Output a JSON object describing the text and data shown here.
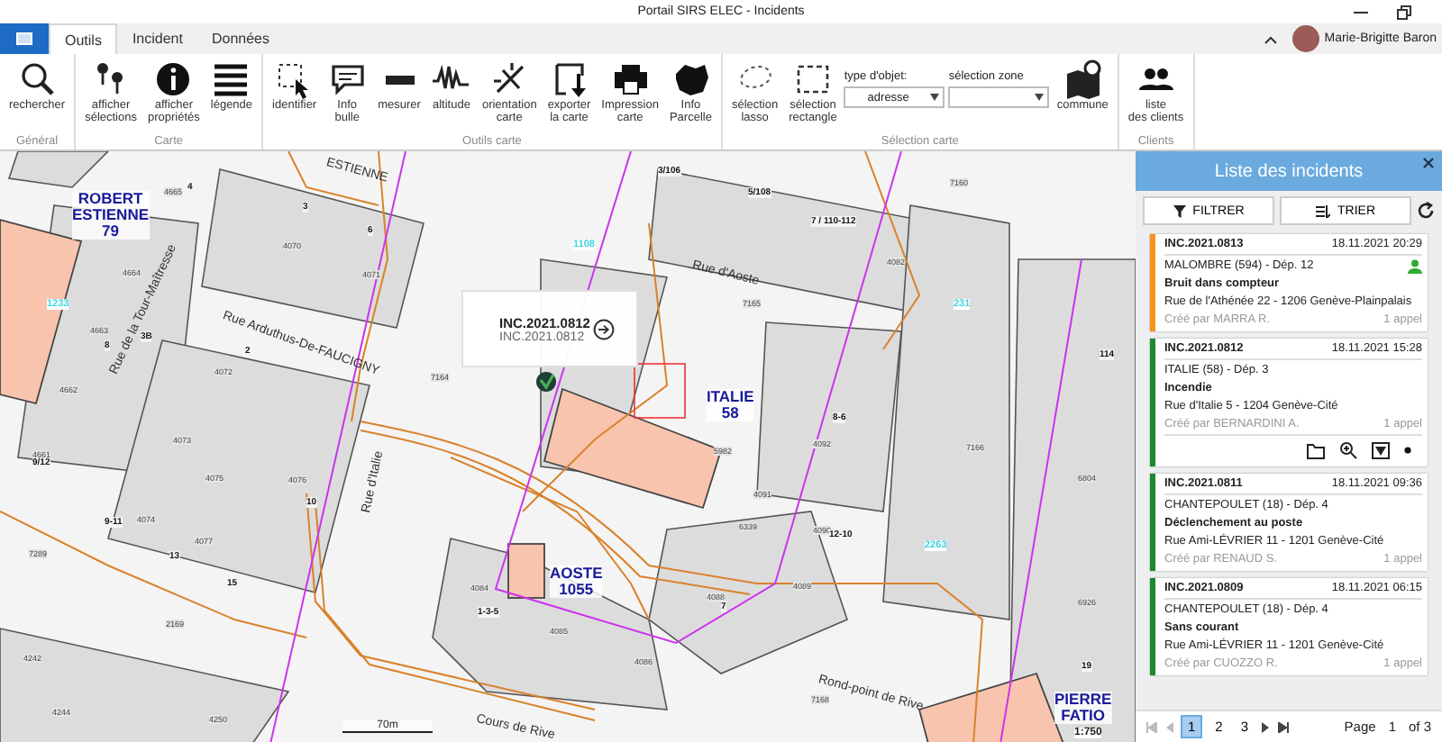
{
  "window": {
    "title": "Portail SIRS ELEC - Incidents"
  },
  "user": {
    "name": "Marie-Brigitte Baron"
  },
  "tabs": [
    {
      "label": "Outils",
      "selected": true
    },
    {
      "label": "Incident",
      "selected": false
    },
    {
      "label": "Données",
      "selected": false
    }
  ],
  "ribbon_groups": [
    {
      "label": "Général",
      "items": [
        {
          "kind": "button",
          "label": "rechercher"
        }
      ]
    },
    {
      "label": "Carte",
      "items": [
        {
          "kind": "button",
          "label": "afficher\nsélections"
        },
        {
          "kind": "button",
          "label": "afficher\npropriétés"
        },
        {
          "kind": "button",
          "label": "légende"
        }
      ]
    },
    {
      "label": "Outils carte",
      "items": [
        {
          "kind": "button",
          "label": "identifier"
        },
        {
          "kind": "button",
          "label": "Info\nbulle"
        },
        {
          "kind": "button",
          "label": "mesurer"
        },
        {
          "kind": "button",
          "label": "altitude"
        },
        {
          "kind": "button",
          "label": "orientation\ncarte"
        },
        {
          "kind": "button",
          "label": "exporter\nla carte"
        },
        {
          "kind": "button",
          "label": "Impression\ncarte"
        },
        {
          "kind": "button",
          "label": "Info\nParcelle"
        }
      ]
    },
    {
      "label": "Sélection carte",
      "items": [
        {
          "kind": "button",
          "label": "sélection\nlasso"
        },
        {
          "kind": "button",
          "label": "sélection\nrectangle"
        },
        {
          "kind": "dropdown",
          "label": "type d'objet:",
          "value": "adresse"
        },
        {
          "kind": "dropdown",
          "label": "sélection zone"
        },
        {
          "kind": "button",
          "label": "commune"
        }
      ]
    },
    {
      "label": "Clients",
      "items": [
        {
          "kind": "button",
          "label": "liste\ndes clients"
        }
      ]
    }
  ],
  "map": {
    "stations": [
      "ROBERT\nESTIENNE\n79",
      "ITALIE\n58",
      "AOSTE\n1055",
      "PIERRE\nFATIO"
    ],
    "streets": [
      "Rue Arduthus-De-FAUCIGNY",
      "Rue d'Aoste",
      "Rue d'Italie",
      "Rue de la Tour-Maîtresse",
      "Rond-point de Rive",
      "Cours de Rive",
      "ESTIENNE"
    ],
    "parcels": [
      "4665",
      "4070",
      "4071",
      "4664",
      "4663",
      "4072",
      "4073",
      "4075",
      "4076",
      "4074",
      "4077",
      "4662",
      "4661",
      "7164",
      "7165",
      "7160",
      "4082",
      "4092",
      "7166",
      "4091",
      "6339",
      "4090",
      "4089",
      "4088",
      "4084",
      "4085",
      "4086",
      "7168",
      "6804",
      "6926",
      "4242",
      "4244",
      "4250",
      "2169",
      "7289",
      "5982"
    ],
    "nodes": [
      "1108",
      "231",
      "2263",
      "1233"
    ],
    "numbers": [
      "3/106",
      "5/108",
      "7 / 110-112",
      "8-6",
      "12-10",
      "9-11",
      "13",
      "15",
      "1-3-5",
      "7",
      "19",
      "114",
      "10",
      "8",
      "2",
      "4",
      "3",
      "6",
      "3B",
      "9/12"
    ],
    "popup": {
      "title": "INC.2021.0812",
      "subtitle": "INC.2021.0812"
    },
    "scale": {
      "distance": "70m",
      "ratio": "1:750"
    }
  },
  "panel": {
    "title": "Liste des incidents",
    "buttons": [
      "FILTRER",
      "TRIER"
    ],
    "incidents": [
      {
        "id": "INC.2021.0813",
        "date": "18.11.2021 20:29",
        "place": "MALOMBRE (594) - Dép. 12",
        "type": "Bruit dans compteur",
        "address": "Rue de l'Athénée 22 - 1206 Genève-Plainpalais",
        "author": "Créé par MARRA R.",
        "calls": "1 appel",
        "color": "#f7941d",
        "assigned": true,
        "expanded": false
      },
      {
        "id": "INC.2021.0812",
        "date": "18.11.2021 15:28",
        "place": "ITALIE (58) - Dép. 3",
        "type": "Incendie",
        "address": "Rue d'Italie 5 - 1204 Genève-Cité",
        "author": "Créé par BERNARDINI A.",
        "calls": "1 appel",
        "color": "#1a8a2e",
        "assigned": false,
        "expanded": true
      },
      {
        "id": "INC.2021.0811",
        "date": "18.11.2021 09:36",
        "place": "CHANTEPOULET (18) - Dép. 4",
        "type": "Déclenchement au poste",
        "address": "Rue Ami-LÉVRIER 11 - 1201 Genève-Cité",
        "author": "Créé par RENAUD S.",
        "calls": "1 appel",
        "color": "#1a8a2e",
        "assigned": false,
        "expanded": false
      },
      {
        "id": "INC.2021.0809",
        "date": "18.11.2021 06:15",
        "place": "CHANTEPOULET (18) - Dép. 4",
        "type": "Sans courant",
        "address": "Rue Ami-LÉVRIER 11 - 1201 Genève-Cité",
        "author": "Créé par CUOZZO R.",
        "calls": "1 appel",
        "color": "#1a8a2e",
        "assigned": false,
        "expanded": false
      }
    ],
    "pages": [
      {
        "label": "1",
        "selected": true
      },
      {
        "label": "2",
        "selected": false
      },
      {
        "label": "3",
        "selected": false
      }
    ],
    "page_label": "Page",
    "page_value": "1",
    "page_total": "of 3"
  }
}
